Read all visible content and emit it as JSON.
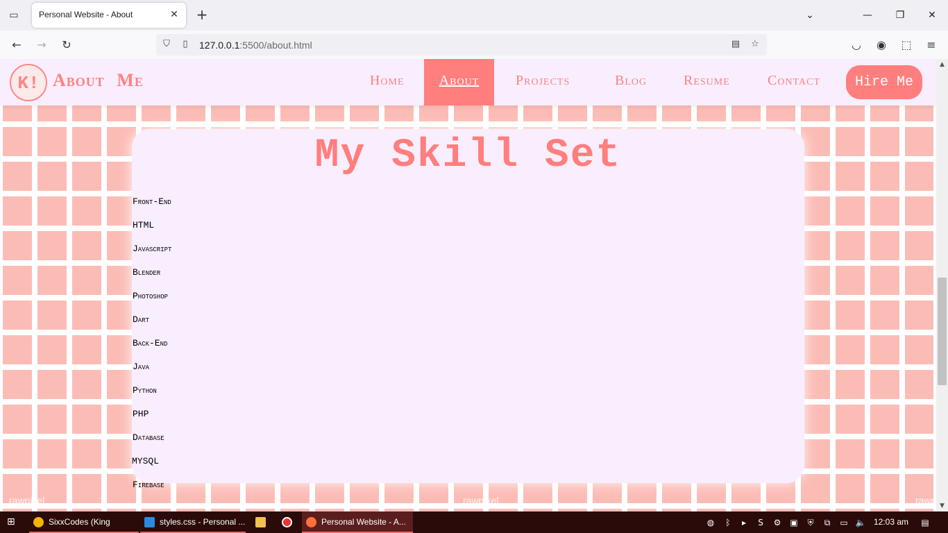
{
  "browser": {
    "tab_title": "Personal Website - About",
    "url_host": "127.0.0.1",
    "url_rest": ":5500/about.html"
  },
  "site": {
    "logo_text": "K!",
    "title": "About  Me",
    "menu": {
      "home": "Home",
      "about": "About",
      "projects": "Projects",
      "blog": "Blog",
      "resume": "Resume",
      "contact": "Contact"
    },
    "hire_label": "Hire Me",
    "watermark": "rawpixel"
  },
  "skills": {
    "heading": "My Skill Set",
    "items": [
      "Front-End",
      "HTML",
      "Javascript",
      "Blender",
      "Photoshop",
      "Dart",
      "Back-End",
      "Java",
      "Python",
      "PHP",
      "Database",
      "MYSQL",
      "Firebase"
    ]
  },
  "taskbar": {
    "tasks": [
      "SixxCodes (King Pand...",
      "styles.css - Personal ...",
      "Personal Website - A..."
    ],
    "time": "12:03 am"
  },
  "colors": {
    "accent": "#ff7e7e",
    "header_bg": "#f9eefe",
    "tile": "#fcbcb6",
    "taskbar": "#2b0a0a"
  }
}
